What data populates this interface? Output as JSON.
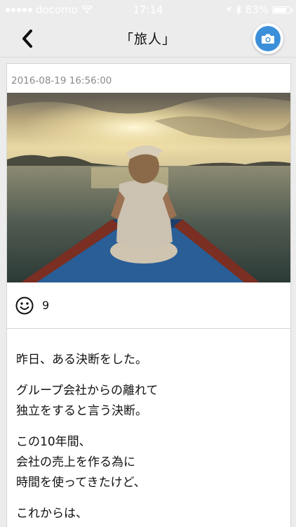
{
  "status_bar": {
    "carrier": "docomo",
    "time": "17:14",
    "battery": "83%",
    "battery_level": 0.83
  },
  "nav": {
    "title": "「旅人」",
    "back_icon": "chevron-left-icon",
    "camera_icon": "camera-icon",
    "camera_color": "#3b8fd9"
  },
  "post": {
    "timestamp": "2016-08-19 16:56:00",
    "photo": "woman-on-boat-at-sunset-photo",
    "reaction_icon": "smiley-icon",
    "like_count": "9",
    "paragraphs": [
      [
        "昨日、ある決断をした。"
      ],
      [
        "グループ会社からの離れて",
        "独立をすると言う決断。"
      ],
      [
        "この10年間、",
        "会社の売上を作る為に",
        "時間を使ってきたけど、"
      ],
      [
        "これからは、"
      ]
    ]
  }
}
